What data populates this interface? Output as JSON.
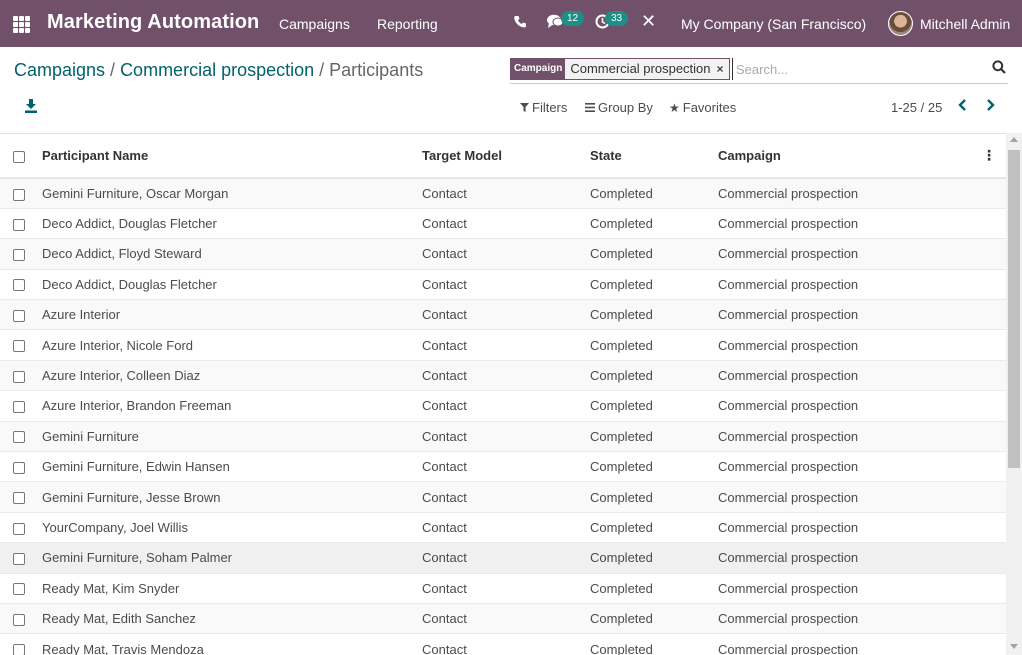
{
  "navbar": {
    "app_title": "Marketing Automation",
    "menu": [
      "Campaigns",
      "Reporting"
    ],
    "chat_count": "12",
    "activity_count": "33",
    "company": "My Company (San Francisco)",
    "user": "Mitchell Admin",
    "color": "#71506a"
  },
  "breadcrumb": {
    "level1": "Campaigns",
    "sep1": " / ",
    "level2": "Commercial prospection",
    "sep2": " / ",
    "current": "Participants"
  },
  "search": {
    "facet_label": "Campaign",
    "facet_value": "Commercial prospection",
    "facet_close": "×",
    "placeholder": "Search..."
  },
  "controls": {
    "filters": "Filters",
    "group_by": "Group By",
    "favorites": "Favorites",
    "pager": "1-25 / 25"
  },
  "table": {
    "headers": [
      "Participant Name",
      "Target Model",
      "State",
      "Campaign"
    ],
    "rows": [
      [
        "Gemini Furniture, Oscar Morgan",
        "Contact",
        "Completed",
        "Commercial prospection"
      ],
      [
        "Deco Addict, Douglas Fletcher",
        "Contact",
        "Completed",
        "Commercial prospection"
      ],
      [
        "Deco Addict, Floyd Steward",
        "Contact",
        "Completed",
        "Commercial prospection"
      ],
      [
        "Deco Addict, Douglas Fletcher",
        "Contact",
        "Completed",
        "Commercial prospection"
      ],
      [
        "Azure Interior",
        "Contact",
        "Completed",
        "Commercial prospection"
      ],
      [
        "Azure Interior, Nicole Ford",
        "Contact",
        "Completed",
        "Commercial prospection"
      ],
      [
        "Azure Interior, Colleen Diaz",
        "Contact",
        "Completed",
        "Commercial prospection"
      ],
      [
        "Azure Interior, Brandon Freeman",
        "Contact",
        "Completed",
        "Commercial prospection"
      ],
      [
        "Gemini Furniture",
        "Contact",
        "Completed",
        "Commercial prospection"
      ],
      [
        "Gemini Furniture, Edwin Hansen",
        "Contact",
        "Completed",
        "Commercial prospection"
      ],
      [
        "Gemini Furniture, Jesse Brown",
        "Contact",
        "Completed",
        "Commercial prospection"
      ],
      [
        "YourCompany, Joel Willis",
        "Contact",
        "Completed",
        "Commercial prospection"
      ],
      [
        "Gemini Furniture, Soham Palmer",
        "Contact",
        "Completed",
        "Commercial prospection"
      ],
      [
        "Ready Mat, Kim Snyder",
        "Contact",
        "Completed",
        "Commercial prospection"
      ],
      [
        "Ready Mat, Edith Sanchez",
        "Contact",
        "Completed",
        "Commercial prospection"
      ],
      [
        "Ready Mat, Travis Mendoza",
        "Contact",
        "Completed",
        "Commercial prospection"
      ]
    ]
  }
}
